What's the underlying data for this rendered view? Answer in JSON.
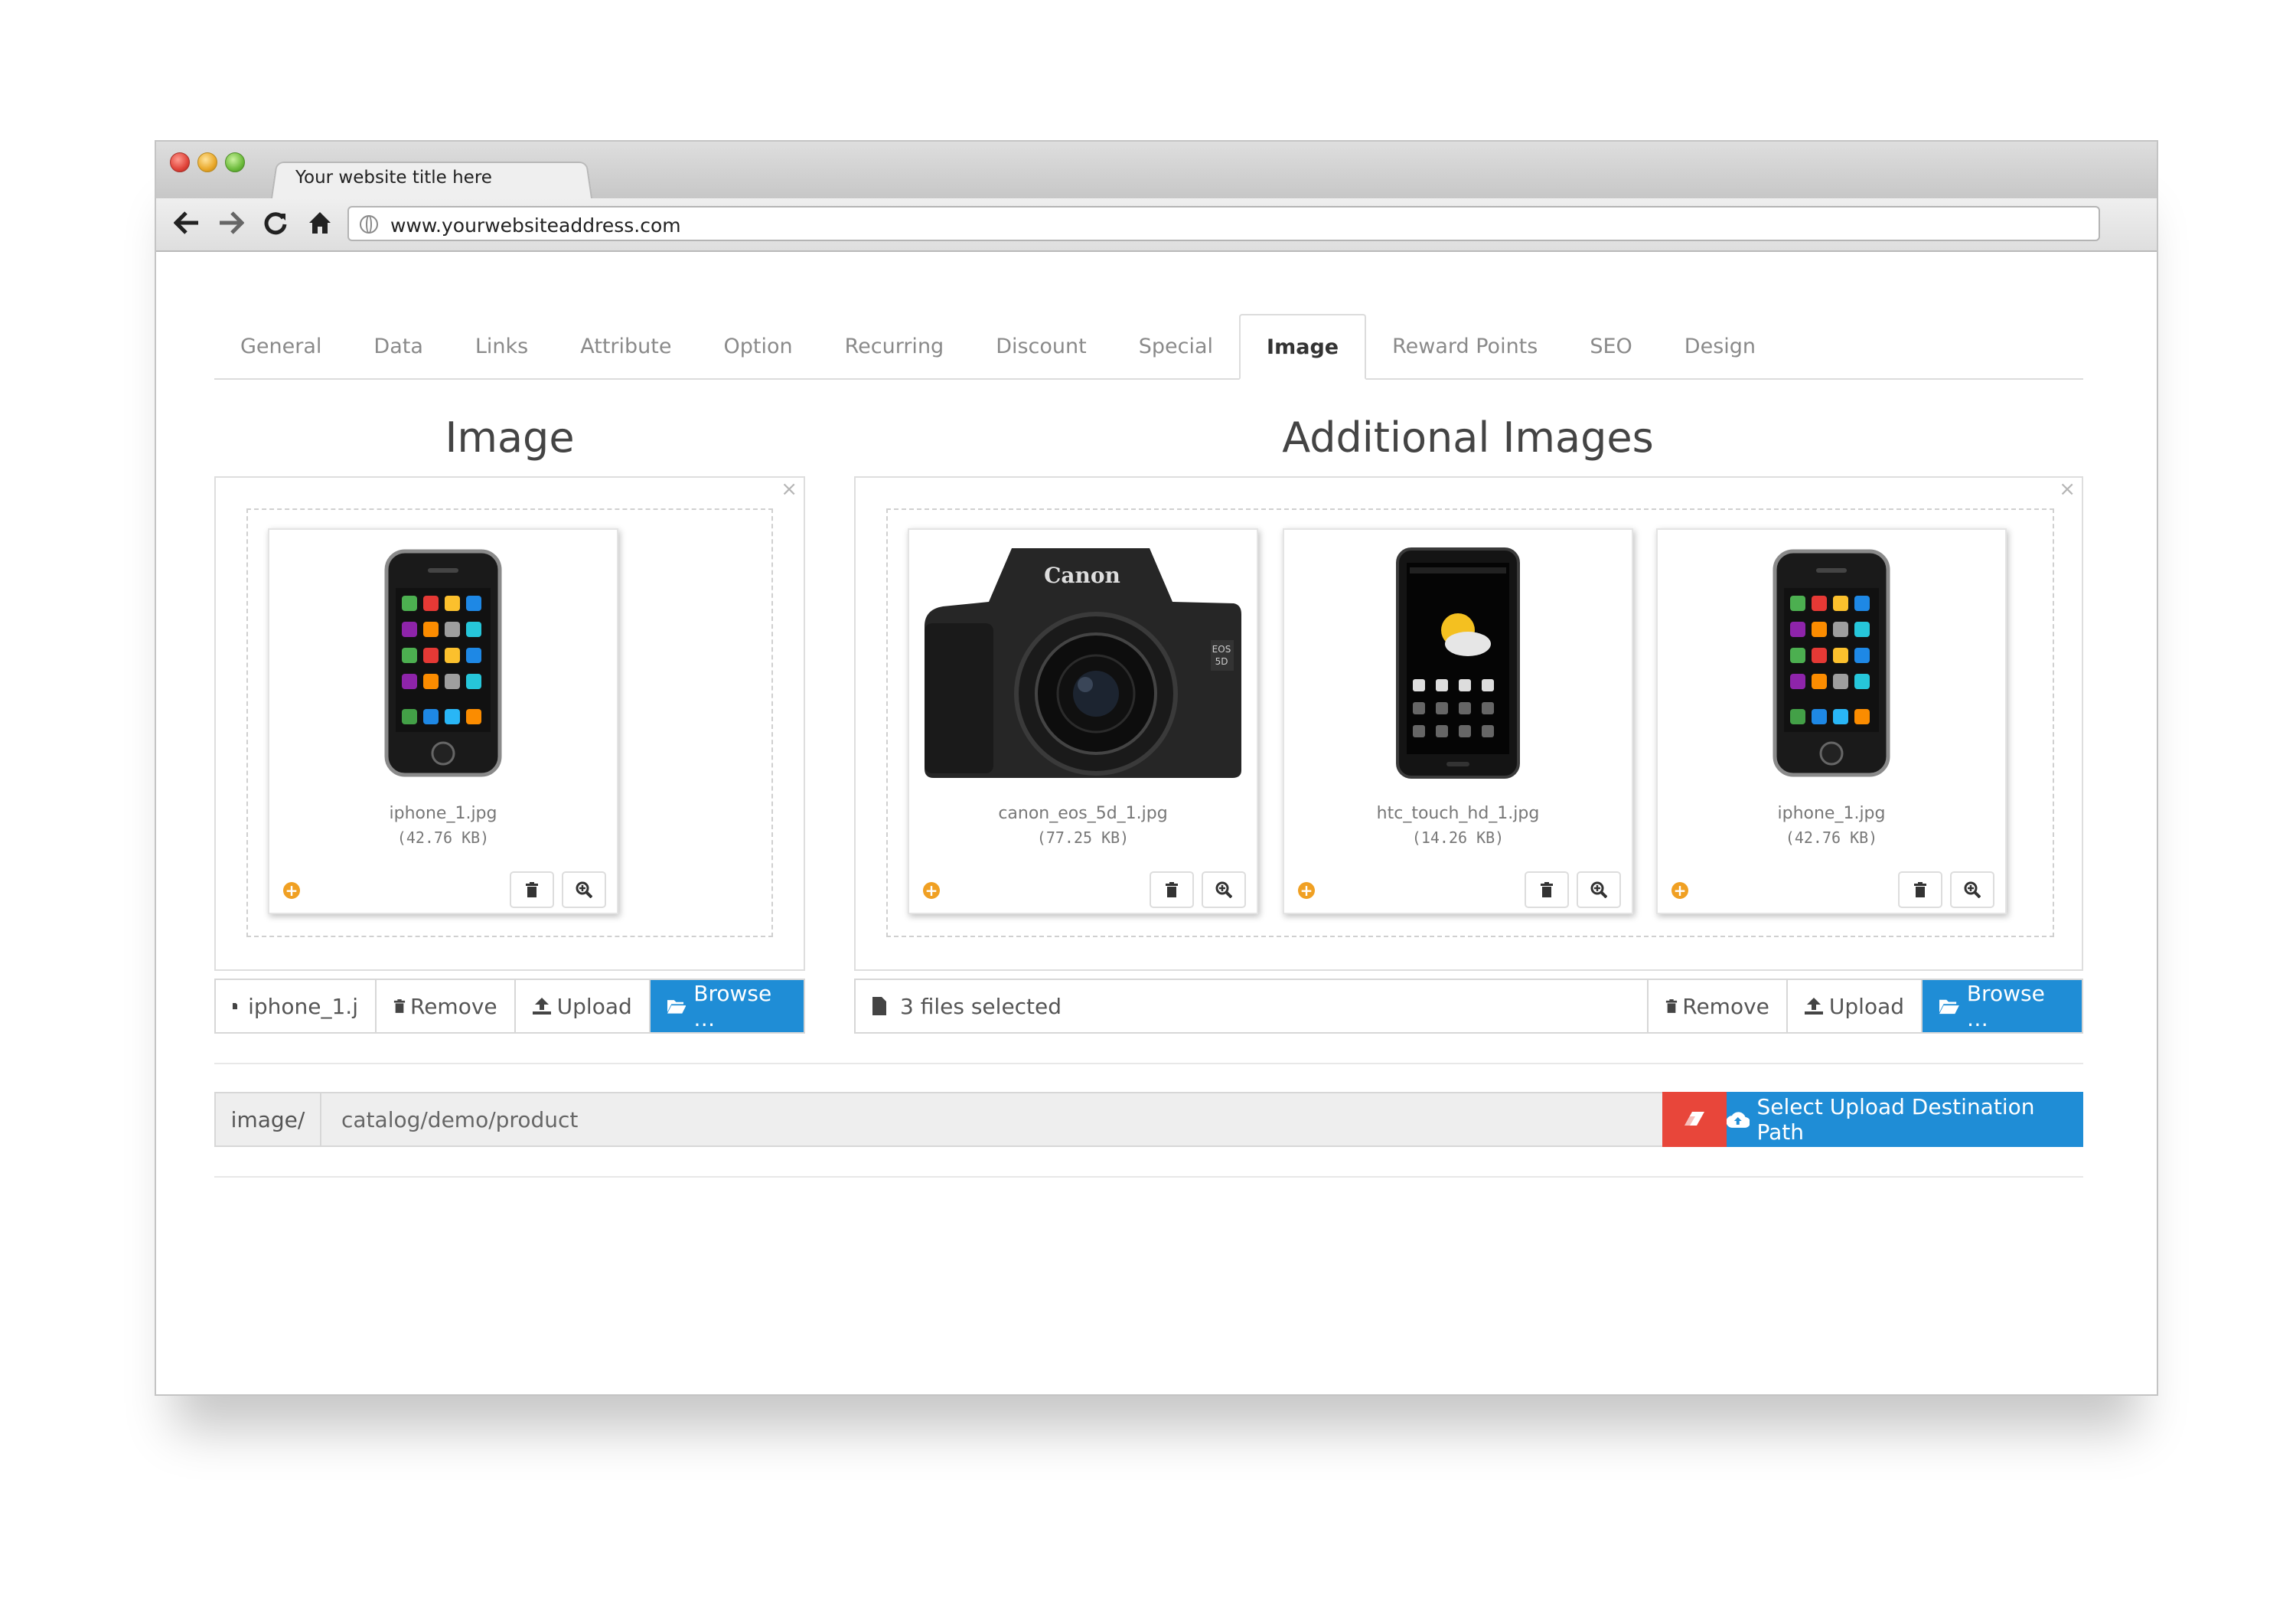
{
  "browser": {
    "tab_title": "Your website title here",
    "url": "www.yourwebsiteaddress.com"
  },
  "tabs": [
    {
      "label": "General"
    },
    {
      "label": "Data"
    },
    {
      "label": "Links"
    },
    {
      "label": "Attribute"
    },
    {
      "label": "Option"
    },
    {
      "label": "Recurring"
    },
    {
      "label": "Discount"
    },
    {
      "label": "Special"
    },
    {
      "label": "Image",
      "active": true
    },
    {
      "label": "Reward Points"
    },
    {
      "label": "SEO"
    },
    {
      "label": "Design"
    }
  ],
  "image_section": {
    "title": "Image",
    "close": "×",
    "files": [
      {
        "name": "iphone_1.jpg",
        "size": "(42.76 KB)",
        "icon": "iphone"
      }
    ],
    "bar": {
      "file_value": "iphone_1.j",
      "remove": "Remove",
      "upload": "Upload",
      "browse": "Browse …"
    }
  },
  "additional_section": {
    "title": "Additional Images",
    "close": "×",
    "files": [
      {
        "name": "canon_eos_5d_1.jpg",
        "size": "(77.25 KB)",
        "icon": "camera"
      },
      {
        "name": "htc_touch_hd_1.jpg",
        "size": "(14.26 KB)",
        "icon": "htc"
      },
      {
        "name": "iphone_1.jpg",
        "size": "(42.76 KB)",
        "icon": "iphone"
      }
    ],
    "bar": {
      "file_value": "3 files selected",
      "remove": "Remove",
      "upload": "Upload",
      "browse": "Browse …"
    }
  },
  "path": {
    "prefix": "image/",
    "value": "catalog/demo/product",
    "select_label": "Select Upload Destination Path"
  },
  "colors": {
    "primary": "#1f8dd6",
    "danger": "#e8463a",
    "add_icon": "#f0a023"
  }
}
